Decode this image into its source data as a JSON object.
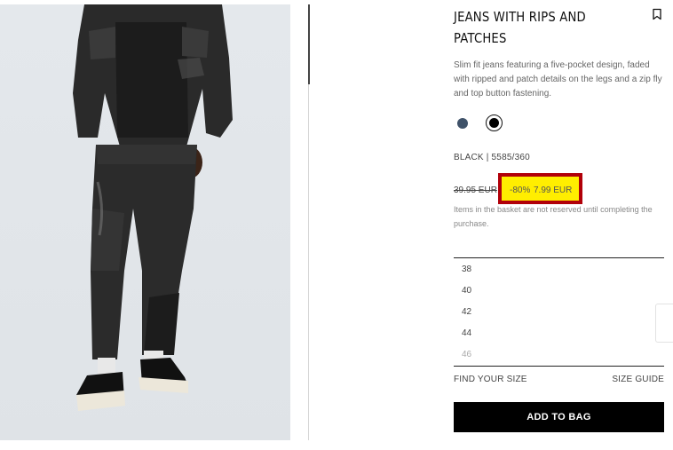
{
  "product": {
    "title_line1": "JEANS WITH RIPS AND",
    "title_line2": "PATCHES",
    "description": "Slim fit jeans featuring a five-pocket design, faded with ripped and patch details on the legs and a zip fly and top button fastening.",
    "color_ref": "BLACK | 5585/360",
    "swatches": [
      {
        "name": "blue",
        "color": "#3f5269"
      },
      {
        "name": "black",
        "color": "#000000",
        "selected": true
      }
    ]
  },
  "price": {
    "old": "39.95 EUR",
    "discount": "-80%",
    "new": "7.99 EUR",
    "highlight_color": "#ffee00",
    "highlight_border": "#b10009"
  },
  "basket_note": "Items in the basket are not reserved until completing the purchase.",
  "sizes": [
    {
      "label": "38",
      "available": true
    },
    {
      "label": "40",
      "available": true
    },
    {
      "label": "42",
      "available": true
    },
    {
      "label": "44",
      "available": true
    },
    {
      "label": "46",
      "available": false
    }
  ],
  "links": {
    "find_size": "FIND YOUR SIZE",
    "size_guide": "SIZE GUIDE"
  },
  "add_to_bag": "ADD TO BAG",
  "icons": {
    "bookmark": "bookmark-icon"
  }
}
